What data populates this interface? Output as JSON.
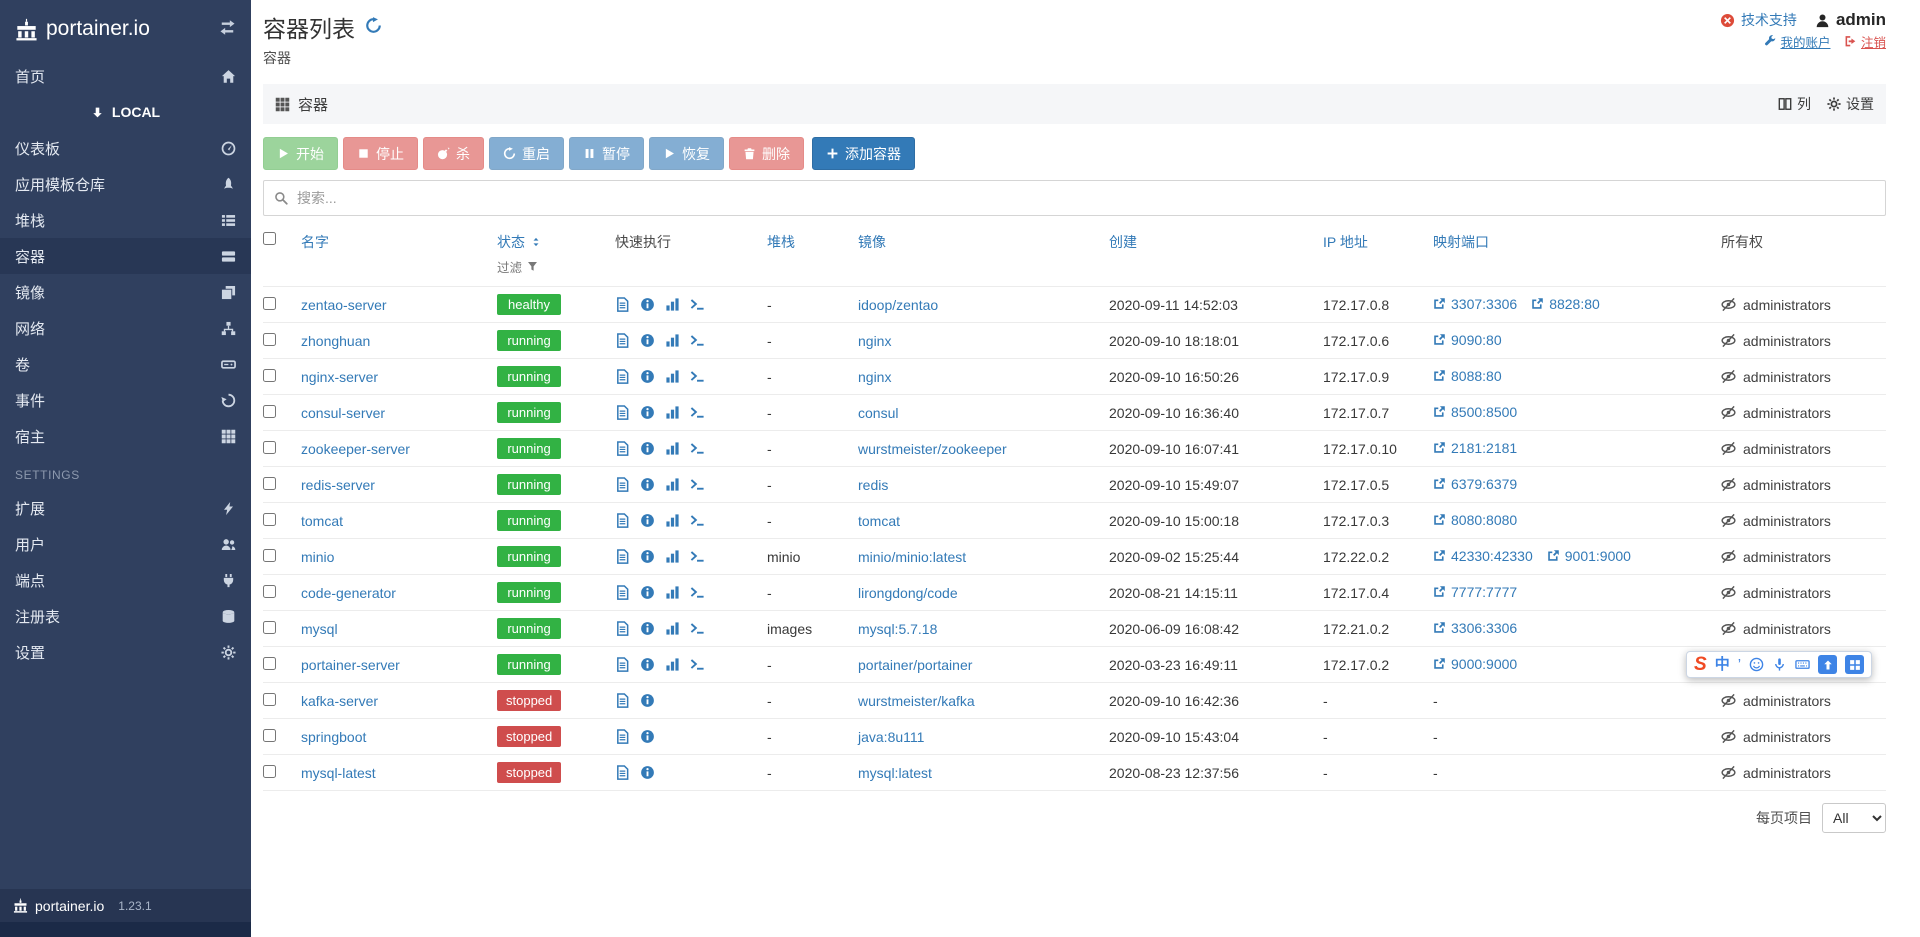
{
  "theme": {
    "accent": "#337ab7",
    "sidebar_bg": "#30405f",
    "sidebar_active_bg": "#283755",
    "badge_success": "#32b244",
    "badge_danger": "#cf4d4d",
    "btn_success": "#5cb85c",
    "btn_danger": "#d9534f",
    "btn_primary": "#337ab7",
    "support_red": "#dd4b39",
    "logout_red": "#d9534f"
  },
  "sidebar": {
    "brand": "portainer.io",
    "home": "首页",
    "endpoint": "LOCAL",
    "menu": [
      {
        "label": "仪表板",
        "icon": "tachometer-icon"
      },
      {
        "label": "应用模板仓库",
        "icon": "rocket-icon"
      },
      {
        "label": "堆栈",
        "icon": "list-icon"
      },
      {
        "label": "容器",
        "icon": "server-icon"
      },
      {
        "label": "镜像",
        "icon": "clone-icon"
      },
      {
        "label": "网络",
        "icon": "sitemap-icon"
      },
      {
        "label": "卷",
        "icon": "hdd-icon"
      },
      {
        "label": "事件",
        "icon": "history-icon"
      },
      {
        "label": "宿主",
        "icon": "grid-icon"
      }
    ],
    "settings_heading": "SETTINGS",
    "settings_menu": [
      {
        "label": "扩展",
        "icon": "bolt-icon"
      },
      {
        "label": "用户",
        "icon": "users-icon"
      },
      {
        "label": "端点",
        "icon": "plug-icon"
      },
      {
        "label": "注册表",
        "icon": "database-icon"
      },
      {
        "label": "设置",
        "icon": "gear-icon"
      }
    ],
    "footer_brand": "portainer.io",
    "version": "1.23.1"
  },
  "header": {
    "title": "容器列表",
    "breadcrumb": "容器",
    "support": "技术支持",
    "username": "admin",
    "my_account": "我的账户",
    "logout": "注销"
  },
  "widget": {
    "title": "容器",
    "columns": "列",
    "settings": "设置"
  },
  "toolbar": {
    "start": "开始",
    "stop": "停止",
    "kill": "杀",
    "restart": "重启",
    "pause": "暂停",
    "resume": "恢复",
    "remove": "删除",
    "add": "添加容器"
  },
  "search": {
    "placeholder": "搜索..."
  },
  "table": {
    "headers": {
      "name": "名字",
      "state": "状态",
      "filter": "过滤",
      "quick_actions": "快速执行",
      "stack": "堆栈",
      "image": "镜像",
      "created": "创建",
      "ip": "IP 地址",
      "ports": "映射端口",
      "ownership": "所有权"
    },
    "rows": [
      {
        "name": "zentao-server",
        "state": "healthy",
        "state_type": "success",
        "running": true,
        "stack": "-",
        "image": "idoop/zentao",
        "created": "2020-09-11 14:52:03",
        "ip": "172.17.0.8",
        "ports": [
          "3307:3306",
          "8828:80"
        ],
        "ownership": "administrators"
      },
      {
        "name": "zhonghuan",
        "state": "running",
        "state_type": "success",
        "running": true,
        "stack": "-",
        "image": "nginx",
        "created": "2020-09-10 18:18:01",
        "ip": "172.17.0.6",
        "ports": [
          "9090:80"
        ],
        "ownership": "administrators"
      },
      {
        "name": "nginx-server",
        "state": "running",
        "state_type": "success",
        "running": true,
        "stack": "-",
        "image": "nginx",
        "created": "2020-09-10 16:50:26",
        "ip": "172.17.0.9",
        "ports": [
          "8088:80"
        ],
        "ownership": "administrators"
      },
      {
        "name": "consul-server",
        "state": "running",
        "state_type": "success",
        "running": true,
        "stack": "-",
        "image": "consul",
        "created": "2020-09-10 16:36:40",
        "ip": "172.17.0.7",
        "ports": [
          "8500:8500"
        ],
        "ownership": "administrators"
      },
      {
        "name": "zookeeper-server",
        "state": "running",
        "state_type": "success",
        "running": true,
        "stack": "-",
        "image": "wurstmeister/zookeeper",
        "created": "2020-09-10 16:07:41",
        "ip": "172.17.0.10",
        "ports": [
          "2181:2181"
        ],
        "ownership": "administrators"
      },
      {
        "name": "redis-server",
        "state": "running",
        "state_type": "success",
        "running": true,
        "stack": "-",
        "image": "redis",
        "created": "2020-09-10 15:49:07",
        "ip": "172.17.0.5",
        "ports": [
          "6379:6379"
        ],
        "ownership": "administrators"
      },
      {
        "name": "tomcat",
        "state": "running",
        "state_type": "success",
        "running": true,
        "stack": "-",
        "image": "tomcat",
        "created": "2020-09-10 15:00:18",
        "ip": "172.17.0.3",
        "ports": [
          "8080:8080"
        ],
        "ownership": "administrators"
      },
      {
        "name": "minio",
        "state": "running",
        "state_type": "success",
        "running": true,
        "stack": "minio",
        "image": "minio/minio:latest",
        "created": "2020-09-02 15:25:44",
        "ip": "172.22.0.2",
        "ports": [
          "42330:42330",
          "9001:9000"
        ],
        "ownership": "administrators"
      },
      {
        "name": "code-generator",
        "state": "running",
        "state_type": "success",
        "running": true,
        "stack": "-",
        "image": "lirongdong/code",
        "created": "2020-08-21 14:15:11",
        "ip": "172.17.0.4",
        "ports": [
          "7777:7777"
        ],
        "ownership": "administrators"
      },
      {
        "name": "mysql",
        "state": "running",
        "state_type": "success",
        "running": true,
        "stack": "images",
        "image": "mysql:5.7.18",
        "created": "2020-06-09 16:08:42",
        "ip": "172.21.0.2",
        "ports": [
          "3306:3306"
        ],
        "ownership": "administrators"
      },
      {
        "name": "portainer-server",
        "state": "running",
        "state_type": "success",
        "running": true,
        "stack": "-",
        "image": "portainer/portainer",
        "created": "2020-03-23 16:49:11",
        "ip": "172.17.0.2",
        "ports": [
          "9000:9000"
        ],
        "ownership": "administrators"
      },
      {
        "name": "kafka-server",
        "state": "stopped",
        "state_type": "danger",
        "running": false,
        "stack": "-",
        "image": "wurstmeister/kafka",
        "created": "2020-09-10 16:42:36",
        "ip": "-",
        "ports": [],
        "ownership": "administrators"
      },
      {
        "name": "springboot",
        "state": "stopped",
        "state_type": "danger",
        "running": false,
        "stack": "-",
        "image": "java:8u111",
        "created": "2020-09-10 15:43:04",
        "ip": "-",
        "ports": [],
        "ownership": "administrators"
      },
      {
        "name": "mysql-latest",
        "state": "stopped",
        "state_type": "danger",
        "running": false,
        "stack": "-",
        "image": "mysql:latest",
        "created": "2020-08-23 12:37:56",
        "ip": "-",
        "ports": [],
        "ownership": "administrators"
      }
    ]
  },
  "pagination": {
    "label": "每页项目",
    "selected": "All"
  },
  "ime": {
    "logo": "S",
    "lang": "中",
    "punct": "’"
  }
}
